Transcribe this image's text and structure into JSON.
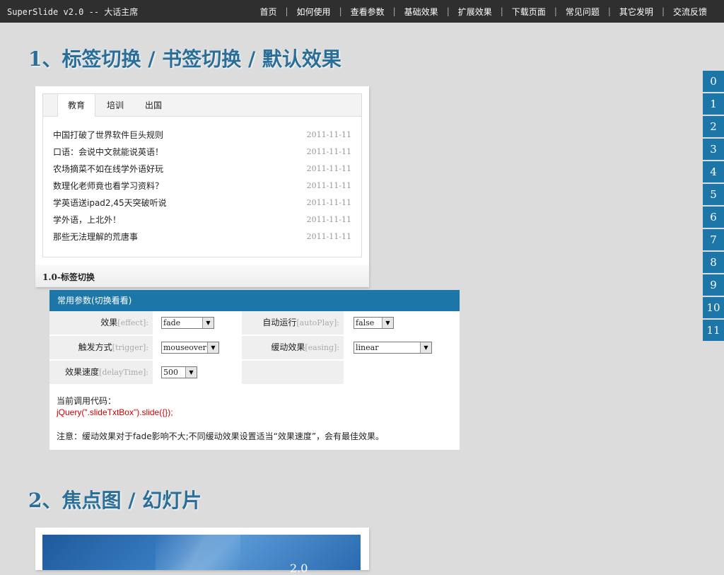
{
  "header": {
    "brand": "SuperSlide v2.0 -- 大话主席",
    "nav": [
      "首页",
      "如何使用",
      "查看参数",
      "基础效果",
      "扩展效果",
      "下载页面",
      "常见问题",
      "其它发明",
      "交流反馈"
    ]
  },
  "section1": {
    "title": "1、标签切换 / 书签切换 / 默认效果"
  },
  "demo": {
    "tabs": [
      "教育",
      "培训",
      "出国"
    ],
    "active_tab": "教育",
    "news": [
      {
        "title": "中国打破了世界软件巨头规则",
        "date": "2011-11-11"
      },
      {
        "title": "口语：会说中文就能说英语！",
        "date": "2011-11-11"
      },
      {
        "title": "农场摘菜不如在线学外语好玩",
        "date": "2011-11-11"
      },
      {
        "title": "数理化老师竟也看学习资料？",
        "date": "2011-11-11"
      },
      {
        "title": "学英语送ipad2,45天突破听说",
        "date": "2011-11-11"
      },
      {
        "title": "学外语，上北外！",
        "date": "2011-11-11"
      },
      {
        "title": "那些无法理解的荒唐事",
        "date": "2011-11-11"
      }
    ],
    "caption": "1.0-标签切换"
  },
  "params": {
    "header": "常用参数(切换看看)",
    "effect": {
      "label": "效果",
      "key": "[effect]:",
      "value": "fade"
    },
    "autoplay": {
      "label": "自动运行",
      "key": "[autoPlay]:",
      "value": "false"
    },
    "trigger": {
      "label": "触发方式",
      "key": "[trigger]:",
      "value": "mouseover"
    },
    "easing": {
      "label": "缓动效果",
      "key": "[easing]:",
      "value": "linear"
    },
    "delay": {
      "label": "效果速度",
      "key": "[delayTime]:",
      "value": "500"
    },
    "code_label": "当前调用代码：",
    "code": "jQuery(\".slideTxtBox\").slide({});",
    "note": "注意：缓动效果对于fade影响不大;不同缓动效果设置适当“效果速度”，会有最佳效果。"
  },
  "side_nav": [
    "0",
    "1",
    "2",
    "3",
    "4",
    "5",
    "6",
    "7",
    "8",
    "9",
    "10",
    "11"
  ],
  "section2": {
    "title": "2、焦点图 / 幻灯片"
  },
  "slide": {
    "banner_text": "2.0"
  },
  "colors": {
    "accent": "#1c77a8",
    "heading": "#2a6e9a",
    "topbar": "#2f2f2f",
    "code": "#cc0000"
  }
}
